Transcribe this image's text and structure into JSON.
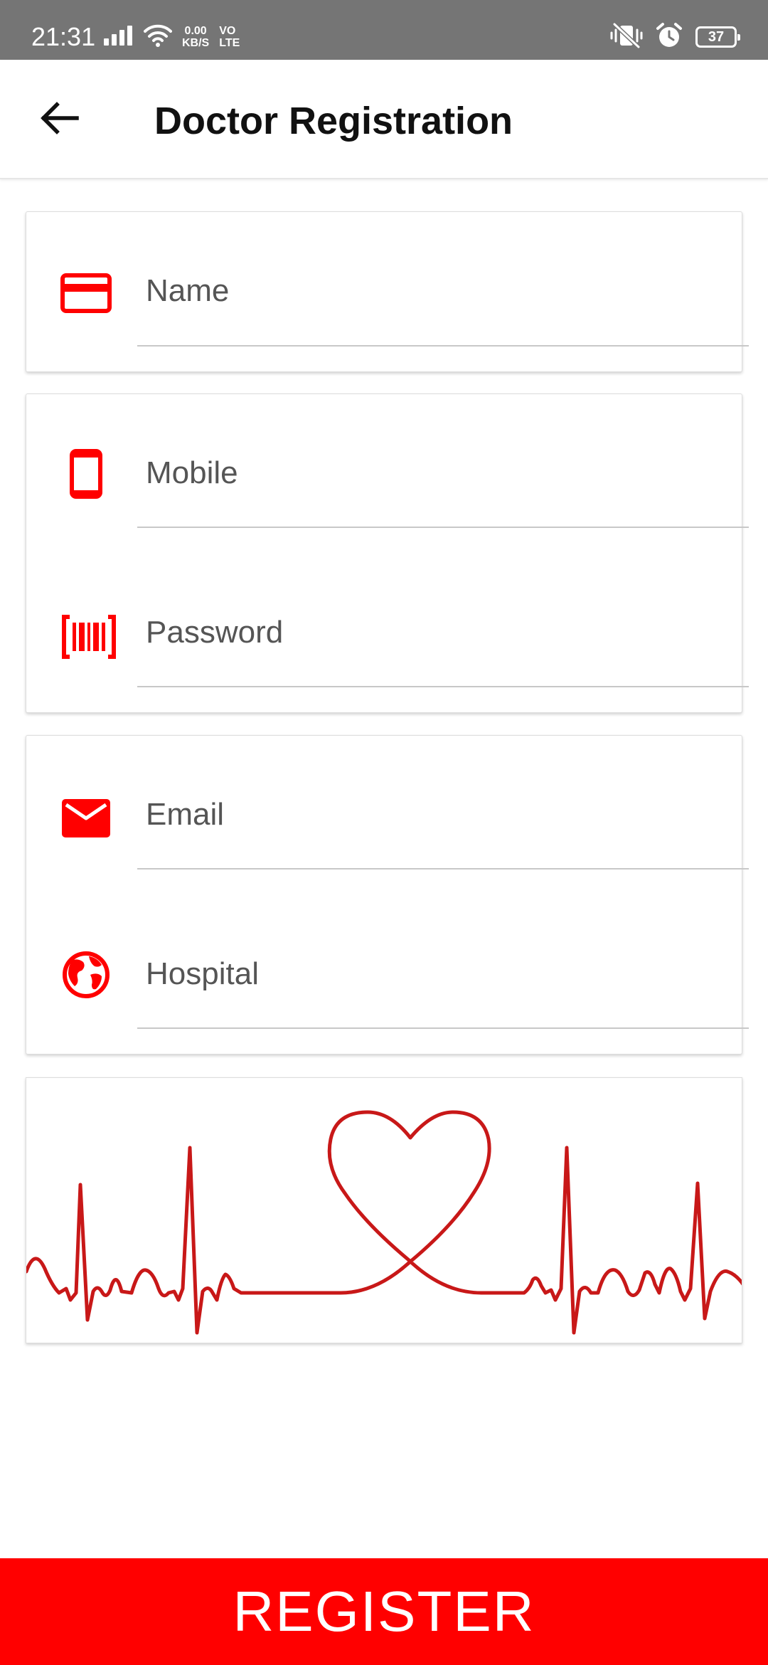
{
  "status_bar": {
    "time": "21:31",
    "net_speed_value": "0.00",
    "net_speed_unit": "KB/S",
    "volte_top": "VO",
    "volte_bottom": "LTE",
    "battery": "37"
  },
  "app_bar": {
    "title": "Doctor Registration"
  },
  "form": {
    "name": {
      "placeholder": "Name",
      "icon": "card-icon"
    },
    "mobile": {
      "placeholder": "Mobile",
      "icon": "phone-icon"
    },
    "password": {
      "placeholder": "Password",
      "icon": "barcode-icon"
    },
    "email": {
      "placeholder": "Email",
      "icon": "mail-icon"
    },
    "hospital": {
      "placeholder": "Hospital",
      "icon": "globe-icon"
    }
  },
  "banner": {
    "illustration": "heartbeat-heart-illustration"
  },
  "register_label": "REGISTER",
  "colors": {
    "accent": "#ff0000",
    "status_bar": "#757575",
    "ecg_line": "#c81818"
  }
}
